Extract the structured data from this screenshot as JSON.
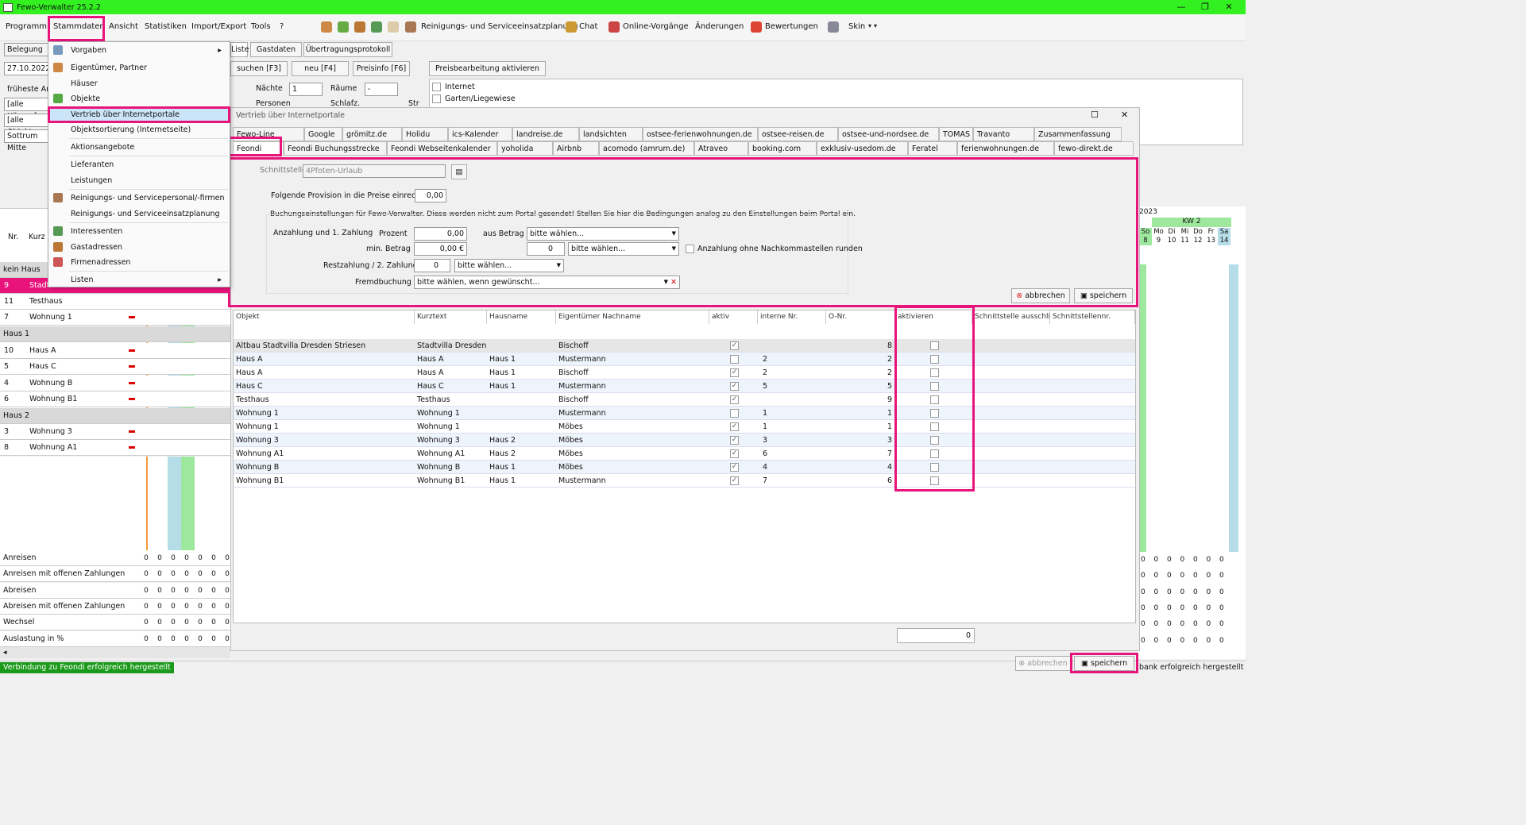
{
  "app": {
    "title": "Fewo-Verwalter 25.2.2"
  },
  "menubar": {
    "items": [
      "Programm",
      "Stammdaten",
      "Ansicht",
      "Statistiken",
      "Import/Export",
      "Tools",
      "?"
    ],
    "toolbar": {
      "reinigung": "Reinigungs- und Serviceeinsatzplanung",
      "chat": "Chat",
      "online": "Online-Vorgänge",
      "aenderungen": "Änderungen",
      "bewertungen": "Bewertungen",
      "skin": "Skin"
    }
  },
  "subtoolbar": {
    "liste": "Liste",
    "gastdaten": "Gastdaten",
    "protokoll": "Übertragungsprotokoll",
    "suchen": "suchen [F3]",
    "neu": "neu [F4]",
    "preisinfo": "Preisinfo [F6]",
    "preisbearbeitung": "Preisbearbeitung aktivieren",
    "naechte": "Nächte",
    "naechte_val": "1",
    "raeume": "Räume",
    "raeume_val": "-",
    "personen": "Personen",
    "schlafz": "Schlafz.",
    "str": "Str",
    "internet": "Internet",
    "garten": "Garten/Liegewiese"
  },
  "dropdown": {
    "items": [
      "Vorgaben",
      "Eigentümer, Partner",
      "Häuser",
      "Objekte",
      "Vertrieb über Internetportale",
      "Objektsortierung (Internetseite)",
      "Aktionsangebote",
      "Lieferanten",
      "Leistungen",
      "Reinigungs- und Servicepersonal/-firmen",
      "Reinigungs- und Serviceeinsatzplanung",
      "Interessenten",
      "Gastadressen",
      "Firmenadressen",
      "Listen"
    ]
  },
  "leftpane": {
    "belegung": "Belegung",
    "date": "27.10.2022",
    "frueheste": "früheste Anre",
    "alle_haeuser": "[alle Häuser]",
    "alle_objekte": "[alle Objekte",
    "sottrum": "Sottrum Mitte",
    "col_nr": "Nr.",
    "col_kurz": "Kurz",
    "rows": [
      {
        "type": "group",
        "label": "kein Haus"
      },
      {
        "nr": "9",
        "kurz": "Stadtvilla Dresden",
        "sel": true
      },
      {
        "nr": "11",
        "kurz": "Testhaus"
      },
      {
        "nr": "7",
        "kurz": "Wohnung 1"
      },
      {
        "type": "group",
        "label": "Haus 1"
      },
      {
        "nr": "10",
        "kurz": "Haus A"
      },
      {
        "nr": "5",
        "kurz": "Haus C"
      },
      {
        "nr": "4",
        "kurz": "Wohnung B"
      },
      {
        "nr": "6",
        "kurz": "Wohnung B1"
      },
      {
        "type": "group",
        "label": "Haus 2"
      },
      {
        "nr": "3",
        "kurz": "Wohnung 3"
      },
      {
        "nr": "8",
        "kurz": "Wohnung A1"
      }
    ],
    "stats": [
      "Anreisen",
      "Anreisen mit offenen Zahlungen",
      "Abreisen",
      "Abreisen mit offenen Zahlungen",
      "Wechsel",
      "Auslastung in %"
    ],
    "stat_val": "0"
  },
  "calendar": {
    "year": "2023",
    "kw": "KW 2",
    "days": [
      "So",
      "Mo",
      "Di",
      "Mi",
      "Do",
      "Fr",
      "Sa"
    ],
    "dates": [
      "8",
      "9",
      "10",
      "11",
      "12",
      "13",
      "14"
    ],
    "stat_val": "0"
  },
  "dialog": {
    "title": "Vertrieb über Internetportale",
    "tabs_row1": [
      "Fewo-Line",
      "Google",
      "grömitz.de",
      "Holidu",
      "ics-Kalender",
      "landreise.de",
      "landsichten",
      "ostsee-ferienwohnungen.de",
      "ostsee-reisen.de",
      "ostsee-und-nordsee.de",
      "TOMAS",
      "Travanto",
      "Zusammenfassung"
    ],
    "tabs_row2": [
      "Feondi",
      "Feondi Buchungsstrecke",
      "Feondi Webseitenkalender",
      "yoholida",
      "Airbnb",
      "acomodo (amrum.de)",
      "Atraveo",
      "booking.com",
      "exklusiv-usedom.de",
      "Feratel",
      "ferienwohnungen.de",
      "fewo-direkt.de"
    ],
    "schnittstelle_label": "Schnittstelle",
    "schnittstelle_val": "4Pfoten-Urlaub",
    "provision_label": "Folgende Provision in die Preise einrechnen",
    "provision_val": "0,00",
    "buchung_note": "Buchungseinstellungen für Fewo-Verwalter. Diese werden nicht zum Portal gesendet! Stellen Sie hier die Bedingungen analog zu den Einstellungen beim Portal ein.",
    "anzahlung_label": "Anzahlung und 1. Zahlung",
    "prozent_label": "Prozent",
    "prozent_val": "0,00",
    "aus_betrag": "aus Betrag",
    "bitte_waehlen": "bitte wählen...",
    "min_betrag_label": "min. Betrag",
    "min_betrag_val": "0,00 €",
    "spin_val": "0",
    "runden": "Anzahlung ohne Nachkommastellen runden",
    "restzahlung_label": "Restzahlung / 2. Zahlung",
    "rest_val": "0",
    "fremdbuchung_label": "Fremdbuchung",
    "fremdbuchung_val": "bitte wählen, wenn gewünscht...",
    "abbrechen": "abbrechen",
    "speichern": "speichern",
    "grid": {
      "headers": [
        "Objekt",
        "Kurztext",
        "Hausname",
        "Eigentümer Nachname",
        "aktiv",
        "interne Nr.",
        "O-Nr.",
        "aktivieren",
        "Schnittstelle ausschli...",
        "Schnittstellennr."
      ],
      "rows": [
        {
          "objekt": "Altbau Stadtvilla Dresden Striesen",
          "kurz": "Stadtvilla Dresden...",
          "haus": "",
          "eig": "Bischoff",
          "aktiv": true,
          "intern": "",
          "onr": "8"
        },
        {
          "objekt": "Haus A",
          "kurz": "Haus A",
          "haus": "Haus 1",
          "eig": "Mustermann",
          "aktiv": false,
          "intern": "2",
          "onr": "2"
        },
        {
          "objekt": "Haus A",
          "kurz": "Haus A",
          "haus": "Haus 1",
          "eig": "Bischoff",
          "aktiv": true,
          "intern": "2",
          "onr": "2"
        },
        {
          "objekt": "Haus C",
          "kurz": "Haus C",
          "haus": "Haus 1",
          "eig": "Mustermann",
          "aktiv": true,
          "intern": "5",
          "onr": "5"
        },
        {
          "objekt": "Testhaus",
          "kurz": "Testhaus",
          "haus": "",
          "eig": "Bischoff",
          "aktiv": true,
          "intern": "",
          "onr": "9"
        },
        {
          "objekt": "Wohnung 1",
          "kurz": "Wohnung 1",
          "haus": "",
          "eig": "Mustermann",
          "aktiv": false,
          "intern": "1",
          "onr": "1"
        },
        {
          "objekt": "Wohnung 1",
          "kurz": "Wohnung 1",
          "haus": "",
          "eig": "Möbes",
          "aktiv": true,
          "intern": "1",
          "onr": "1"
        },
        {
          "objekt": "Wohnung 3",
          "kurz": "Wohnung 3",
          "haus": "Haus 2",
          "eig": "Möbes",
          "aktiv": true,
          "intern": "3",
          "onr": "3"
        },
        {
          "objekt": "Wohnung A1",
          "kurz": "Wohnung A1",
          "haus": "Haus 2",
          "eig": "Möbes",
          "aktiv": true,
          "intern": "6",
          "onr": "7"
        },
        {
          "objekt": "Wohnung B",
          "kurz": "Wohnung B",
          "haus": "Haus 1",
          "eig": "Möbes",
          "aktiv": true,
          "intern": "4",
          "onr": "4"
        },
        {
          "objekt": "Wohnung B1",
          "kurz": "Wohnung B1",
          "haus": "Haus 1",
          "eig": "Mustermann",
          "aktiv": true,
          "intern": "7",
          "onr": "6"
        }
      ],
      "footer_count": "0"
    },
    "bottom_abbrechen": "abbrechen",
    "bottom_speichern": "speichern"
  },
  "status": {
    "left": "Verbindung zu Feondi erfolgreich hergestellt",
    "right": "bank erfolgreich hergestellt"
  },
  "colors": {
    "titlebar": "#33f020",
    "highlight": "#e8147c",
    "status_green": "#1a9a1a"
  }
}
